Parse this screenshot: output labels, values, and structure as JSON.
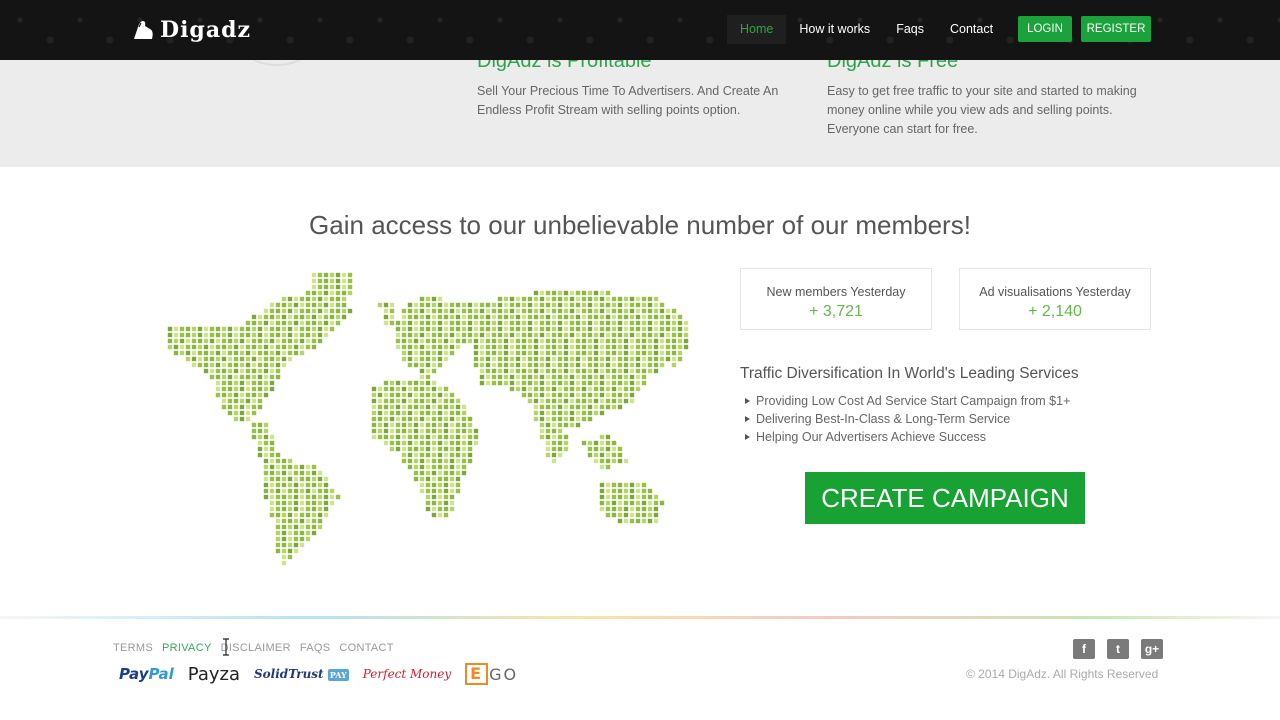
{
  "brand": {
    "name": "Digadz"
  },
  "nav": {
    "items": [
      {
        "label": "Home",
        "active": true
      },
      {
        "label": "How it works",
        "active": false
      },
      {
        "label": "Faqs",
        "active": false
      },
      {
        "label": "Contact",
        "active": false
      }
    ],
    "login": "LOGIN",
    "register": "REGISTER"
  },
  "features": [
    {
      "title": "DigAdz is Profitable",
      "text": "Sell Your Precious Time To Advertisers. And Create An Endless Profit Stream with selling points option."
    },
    {
      "title": "DigAdz is Free",
      "text": "Easy to get free traffic to your site and started to making money online while you view ads and selling points. Everyone can start for free."
    }
  ],
  "headline": "Gain access to our unbelievable number of our members!",
  "stats": [
    {
      "label": "New members Yesterday",
      "value": "+ 3,721"
    },
    {
      "label": "Ad visualisations Yesterday",
      "value": "+ 2,140"
    }
  ],
  "traffic": {
    "title": "Traffic Diversification In World's Leading Services",
    "items": [
      "Providing Low Cost Ad Service Start Campaign from $1+",
      "Delivering Best-In-Class & Long-Term Service",
      "Helping Our Advertisers Achieve Success"
    ]
  },
  "cta": "CREATE CAMPAIGN",
  "footer": {
    "links": [
      {
        "label": "TERMS",
        "active": false
      },
      {
        "label": "PRIVACY",
        "active": true
      },
      {
        "label": "DISCLAIMER",
        "active": false
      },
      {
        "label": "FAQS",
        "active": false
      },
      {
        "label": "CONTACT",
        "active": false
      }
    ],
    "payments": {
      "paypal_a": "Pay",
      "paypal_b": "Pal",
      "payza": "Payza",
      "solidtrust_a": "SolidTrust",
      "solidtrust_b": "PAY",
      "perfectmoney": "Perfect Money",
      "ego_e": "E",
      "ego_rest": "GO"
    },
    "social": [
      {
        "icon": "facebook-icon",
        "glyph": "f"
      },
      {
        "icon": "twitter-icon",
        "glyph": "t"
      },
      {
        "icon": "google-plus-icon",
        "glyph": "g+"
      }
    ],
    "copyright": "© 2014 DigAdz. All Rights Reserved"
  },
  "colors": {
    "accent": "#1aa33a",
    "link_active": "#27a844",
    "map_dot": "#9bc04a"
  }
}
